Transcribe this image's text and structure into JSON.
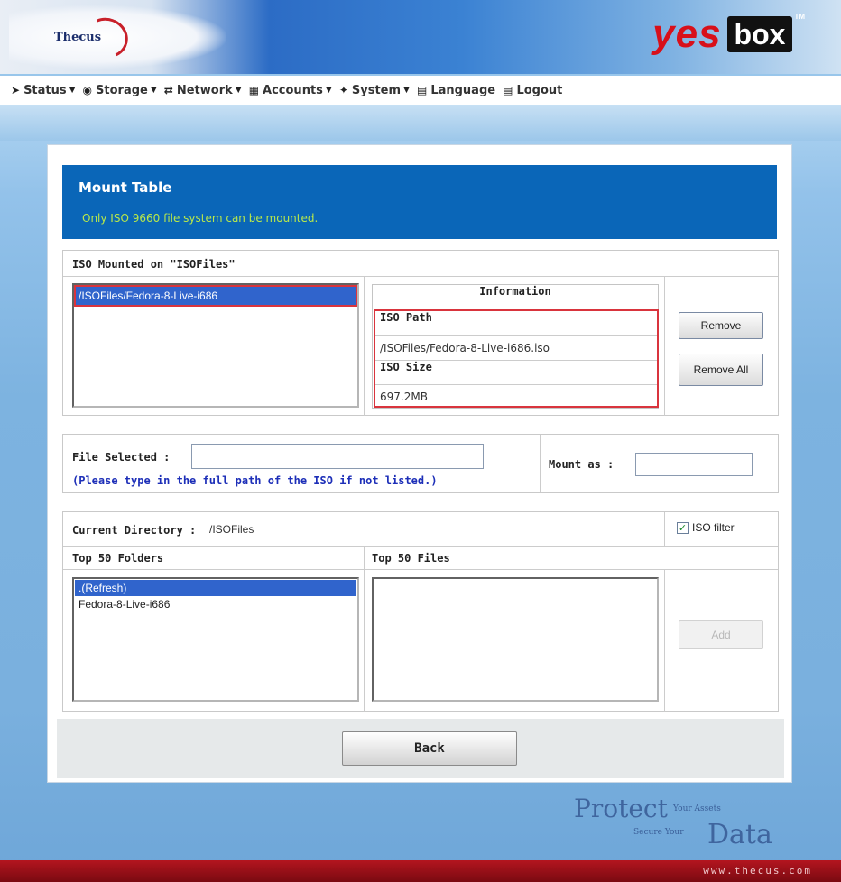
{
  "header": {
    "thecus_logo": "Thecus",
    "brand_yes": "yes",
    "brand_box": "box",
    "brand_tm": "TM"
  },
  "menu": [
    {
      "label": "Status",
      "icon": "arrow-icon",
      "has_dropdown": true
    },
    {
      "label": "Storage",
      "icon": "disk-icon",
      "has_dropdown": true
    },
    {
      "label": "Network",
      "icon": "network-icon",
      "has_dropdown": true
    },
    {
      "label": "Accounts",
      "icon": "users-icon",
      "has_dropdown": true
    },
    {
      "label": "System",
      "icon": "tools-icon",
      "has_dropdown": true
    },
    {
      "label": "Language",
      "icon": "language-icon",
      "has_dropdown": false
    },
    {
      "label": "Logout",
      "icon": "logout-icon",
      "has_dropdown": false
    }
  ],
  "mount": {
    "title": "Mount Table",
    "subtitle": "Only ISO 9660 file system can be mounted."
  },
  "mounted": {
    "label": "ISO Mounted on \"ISOFiles\"",
    "items": [
      "/ISOFiles/Fedora-8-Live-i686"
    ],
    "selected_index": 0,
    "info_header": "Information",
    "iso_path_label": "ISO Path",
    "iso_path_value": "/ISOFiles/Fedora-8-Live-i686.iso",
    "iso_size_label": "ISO Size",
    "iso_size_value": "697.2MB",
    "remove_label": "Remove",
    "remove_all_label": "Remove All"
  },
  "file_select": {
    "label": "File Selected :",
    "value": "",
    "hint": "(Please type in the full path of the ISO if not listed.)",
    "mount_as_label": "Mount as :",
    "mount_as_value": ""
  },
  "directory": {
    "label": "Current Directory :",
    "value": "/ISOFiles",
    "iso_filter_label": "ISO filter",
    "iso_filter_checked": true,
    "folders_header": "Top 50 Folders",
    "files_header": "Top 50 Files",
    "folders": [
      ".(Refresh)",
      "Fedora-8-Live-i686"
    ],
    "folders_selected_index": 0,
    "files": [],
    "add_label": "Add"
  },
  "back_label": "Back",
  "footer": {
    "protect": "Protect",
    "your_assets": "Your Assets",
    "secure_your": "Secure Your",
    "data": "Data",
    "url": "www.thecus.com"
  },
  "colors": {
    "header_blue": "#0a66b8",
    "subtitle_green": "#b8e84a",
    "selection_blue": "#3064cc",
    "highlight_red": "#d9343d",
    "hint_blue": "#1d2fb8"
  }
}
